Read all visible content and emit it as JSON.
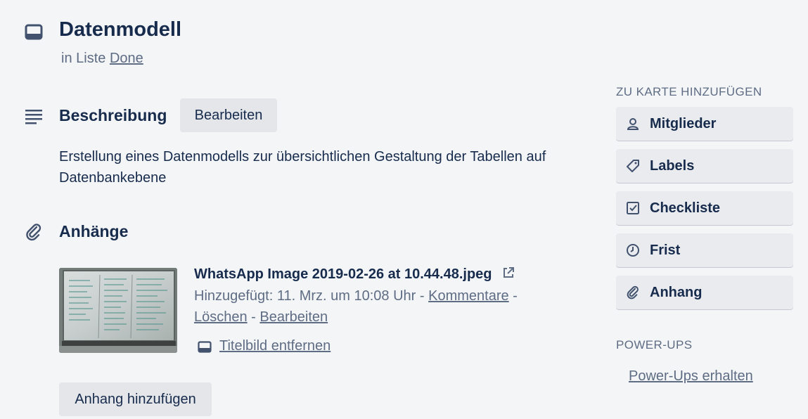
{
  "card": {
    "title": "Datenmodell",
    "list_prefix": "in Liste",
    "list_name": "Done"
  },
  "description": {
    "heading": "Beschreibung",
    "edit_button": "Bearbeiten",
    "text": "Erstellung eines Datenmodells zur übersichtlichen Gestaltung der Tabellen auf Datenbankebene"
  },
  "attachments": {
    "heading": "Anhänge",
    "items": [
      {
        "filename": "WhatsApp Image 2019-02-26 at 10.44.48.jpeg",
        "added_text": "Hinzugefügt: 11. Mrz. um 10:08 Uhr",
        "sep1": " - ",
        "comments_link": "Kommentare",
        "sep2": " -",
        "delete_link": "Löschen",
        "sep3": " - ",
        "edit_link": "Bearbeiten",
        "remove_cover_link": "Titelbild entfernen"
      }
    ],
    "add_button": "Anhang hinzufügen"
  },
  "sidebar": {
    "add_to_card_heading": "ZU KARTE HINZUFÜGEN",
    "buttons": [
      {
        "label": "Mitglieder",
        "icon": "person-icon"
      },
      {
        "label": "Labels",
        "icon": "tag-icon"
      },
      {
        "label": "Checkliste",
        "icon": "checklist-icon"
      },
      {
        "label": "Frist",
        "icon": "clock-icon"
      },
      {
        "label": "Anhang",
        "icon": "paperclip-icon"
      }
    ],
    "powerups_heading": "POWER-UPS",
    "powerups_link": "Power-Ups erhalten"
  },
  "colors": {
    "background": "#f4f5f7",
    "text_primary": "#172b4d",
    "text_secondary": "#5e6c84",
    "button_bg": "#e4e6ea"
  }
}
